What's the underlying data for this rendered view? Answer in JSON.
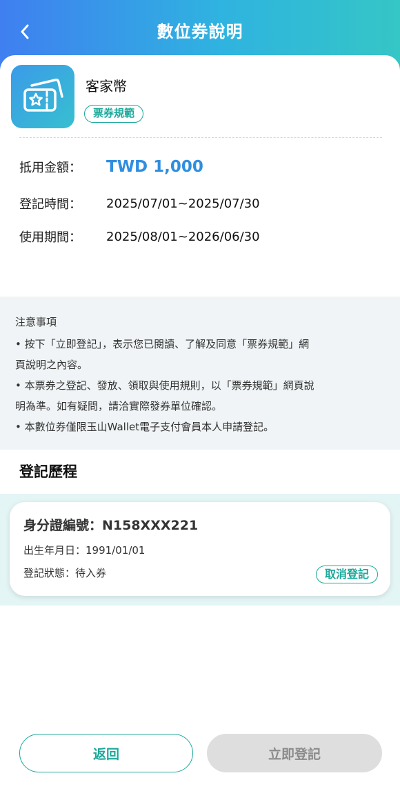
{
  "header": {
    "title": "數位券說明",
    "back_icon": "chevron-left-icon"
  },
  "coupon": {
    "icon": "ticket-star-icon",
    "name": "客家幣",
    "rules_label": "票券規範"
  },
  "details": {
    "amount_label": "抵用金額：",
    "amount_value": "TWD 1,000",
    "register_label": "登記時間：",
    "register_value": "2025/07/01~2025/07/30",
    "usage_label": "使用期間：",
    "usage_value": "2025/08/01~2026/06/30"
  },
  "notice": {
    "title": "注意事項",
    "items": [
      "• 按下「立即登記」，表示您已閱讀、了解及同意「票券規範」網",
      "頁說明之內容。",
      "• 本票券之登記、發放、領取與使用規則，以「票券規範」網頁說",
      "明為準。如有疑問，請洽實際發券單位確認。",
      "• 本數位券僅限玉山Wallet電子支付會員本人申請登記。"
    ]
  },
  "history": {
    "title": "登記歷程",
    "record": {
      "id_line": "身分證編號：N158XXX221",
      "birth_line": "出生年月日：1991/01/01",
      "status_line": "登記狀態：待入券",
      "cancel_label": "取消登記"
    }
  },
  "footer": {
    "return_label": "返回",
    "register_label": "立即登記"
  },
  "colors": {
    "accent_teal": "#1aa89a",
    "amount_blue": "#2f8ee0",
    "header_start": "#3f7ff0",
    "header_end": "#35c6c6"
  }
}
